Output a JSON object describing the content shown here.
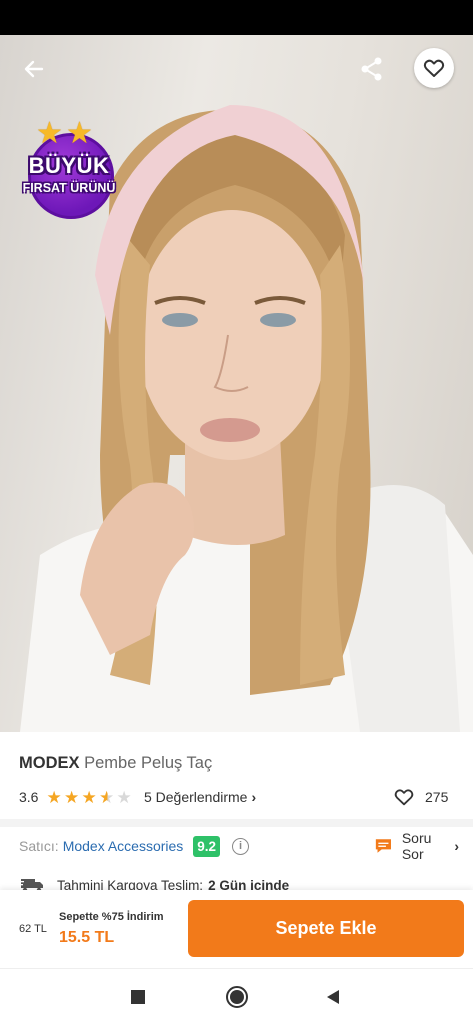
{
  "badge": {
    "line1": "BÜYÜK",
    "line2": "FIRSAT ÜRÜNÜ"
  },
  "product": {
    "brand": "MODEX",
    "name": "Pembe Peluş Taç"
  },
  "rating": {
    "value": "3.6",
    "score": 3.6,
    "max": 5,
    "reviews_label": "5 Değerlendirme"
  },
  "likes": {
    "count": "275"
  },
  "seller": {
    "label": "Satıcı:",
    "name": "Modex Accessories",
    "score": "9.2"
  },
  "ask": {
    "label": "Soru Sor"
  },
  "shipping": {
    "label": "Tahmini Kargoya Teslim:",
    "value": "2 Gün içinde"
  },
  "price": {
    "old": "62 TL",
    "promo": "Sepette %75 İndirim",
    "new": "15.5 TL"
  },
  "cart": {
    "label": "Sepete Ekle"
  },
  "colors": {
    "accent": "#f27a1a",
    "score_green": "#2ec168",
    "link_blue": "#2b6cb0",
    "badge_purple": "#6d17b8"
  },
  "icons": [
    "back-arrow-icon",
    "share-icon",
    "heart-icon",
    "info-icon",
    "chat-icon",
    "truck-icon",
    "square-nav-icon",
    "circle-nav-icon",
    "triangle-nav-icon"
  ]
}
